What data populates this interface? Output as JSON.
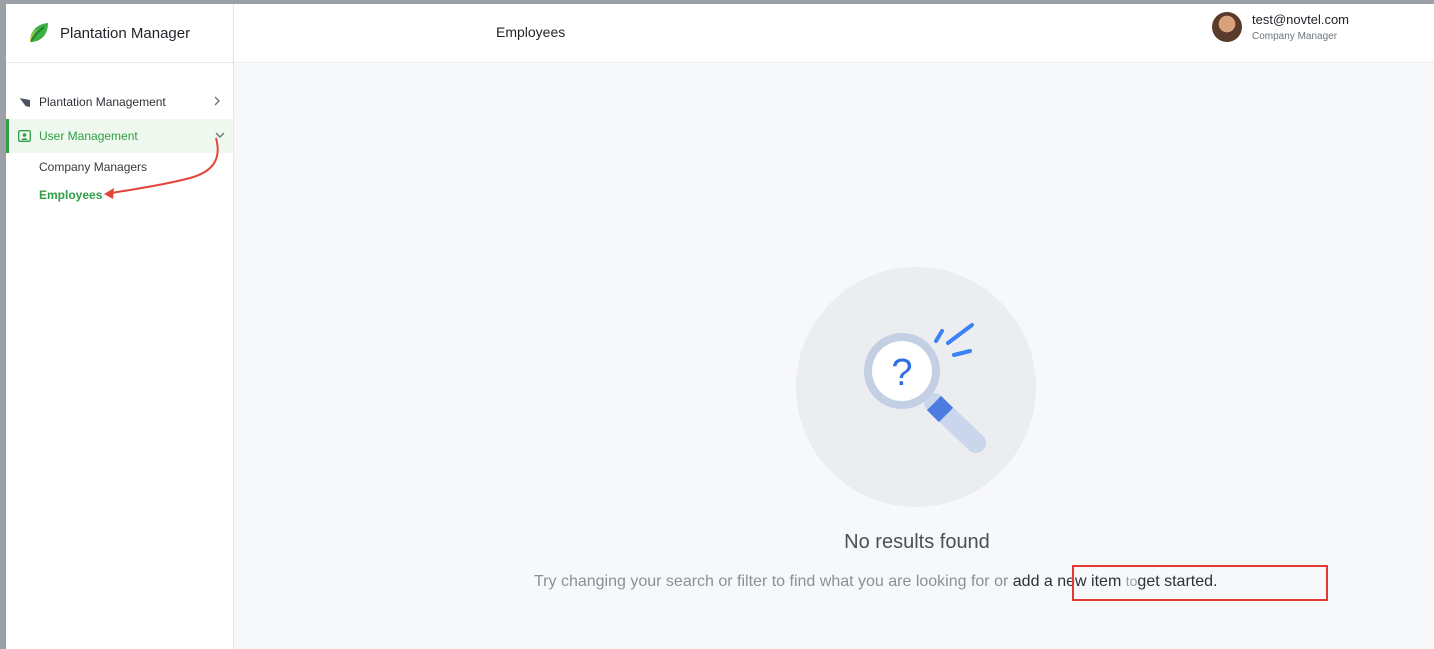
{
  "brand": {
    "name": "Plantation Manager",
    "accent": "#2f9e44"
  },
  "sidebar": {
    "items": [
      {
        "label": "Plantation Management",
        "icon": "leaf-icon",
        "expanded": false
      },
      {
        "label": "User Management",
        "icon": "user-card-icon",
        "expanded": true,
        "children": [
          {
            "label": "Company Managers"
          },
          {
            "label": "Employees",
            "active": true
          }
        ]
      }
    ]
  },
  "header": {
    "title": "Employees",
    "user": {
      "email": "test@novtel.com",
      "role": "Company Manager"
    }
  },
  "empty_state": {
    "title": "No results found",
    "subtitle_prefix": "Try changing your search or filter to find what you are looking for or",
    "subtitle_link": "add a new item",
    "subtitle_mid": "to",
    "subtitle_suffix": "get started."
  },
  "annotation": {
    "highlight_color": "#e53935"
  }
}
